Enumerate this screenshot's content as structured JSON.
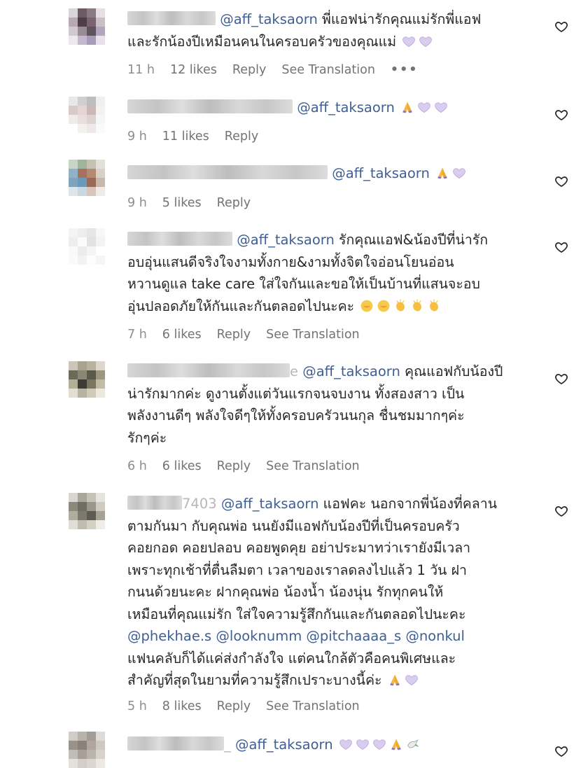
{
  "comments": [
    {
      "mention": "@aff_taksaorn",
      "text": " พี่แอฟน่ารักคุณแม่รักพี่แอฟ\nและรักน้องปีเหมือนคนในครอบครัวของคุณแม่ ",
      "time": "11 h",
      "likes": "12 likes",
      "reply": "Reply",
      "translate": "See Translation",
      "more": "•••"
    },
    {
      "mention": "@aff_taksaorn",
      "text": " ",
      "time": "9 h",
      "likes": "11 likes",
      "reply": "Reply"
    },
    {
      "mention": "@aff_taksaorn",
      "text": " ",
      "time": "9 h",
      "likes": "5 likes",
      "reply": "Reply"
    },
    {
      "mention": "@aff_taksaorn",
      "text": " รักคุณแอฟ&น้องปีที่น่ารัก\nอบอุ่นแสนดีจริงใจงามทั้งกาย&งามทั้งจิตใจอ่อนโยนอ่อน\nหวานดูแล take care ใส่ใจกันและขอให้เป็นบ้านที่แสนจะอบ\nอุ่นปลอดภัยให้กันและกันตลอดไปนะคะ ",
      "time": "7 h",
      "likes": "6 likes",
      "reply": "Reply",
      "translate": "See Translation"
    },
    {
      "name_suffix": "e",
      "mention": "@aff_taksaorn",
      "text": " คุณแอฟกับน้องปี\nน่ารักมากค่ะ ดูงานตั้งแต่วันแรกจนจบงาน ทั้งสองสาว เป็น\nพลังงานดีๆ พลังใจดีๆให้ทั้งครอบครัวนนกุล ชื่นชมมากๆค่ะ\nรักๆค่ะ",
      "time": "6 h",
      "likes": "6 likes",
      "reply": "Reply",
      "translate": "See Translation"
    },
    {
      "name_suffix": "7403",
      "mention": "@aff_taksaorn",
      "text": " แอฟคะ นอกจากพี่น้องที่คลาน\nตามกันมา กับคุณพ่อ นนยังมีแอฟกับน้องปีที่เป็นครอบครัว\nคอยกอด คอยปลอบ คอยพูดคุย อย่าประมาทว่าเรายังมีเวลา\nเพราะทุกเช้าที่ตื่นลืมตา เวลาของเราลดลงไปแล้ว 1 วัน ฝา\nกนนด้วยนะคะ ฝากคุณพ่อ น้องน้ำ น้องนุ่น รักทุกคนให้\nเหมือนที่คุณแม่รัก ใส่ใจความรู้สึกกันและกันตลอดไปนะคะ\n",
      "tags": [
        "@phekhae.s",
        "@looknumm",
        "@pitchaaaa_s",
        "@nonkul"
      ],
      "text2": "\nแฟนคลับก็ได้แค่ส่งกำลังใจ แต่คนใกล้ตัวคือคนพิเศษและ\nสำคัญที่สุดในยามที่ความรู้สึกเปราะบางนี้ค่ะ ",
      "time": "5 h",
      "likes": "8 likes",
      "reply": "Reply",
      "translate": "See Translation"
    },
    {
      "name_suffix": "_",
      "mention": "@aff_taksaorn",
      "text": " "
    }
  ],
  "icons": {
    "heart": "heart-outline-icon",
    "purple_heart": "purple-heart-emoji",
    "pray": "folded-hands-emoji",
    "clap": "clapping-hands-emoji",
    "kiss": "smiling-face-emoji",
    "dove": "dove-emoji"
  },
  "colors": {
    "mention": "#3e5f94",
    "meta": "#8e8e8e",
    "text": "#262626",
    "purple": "#c9b8e8"
  }
}
